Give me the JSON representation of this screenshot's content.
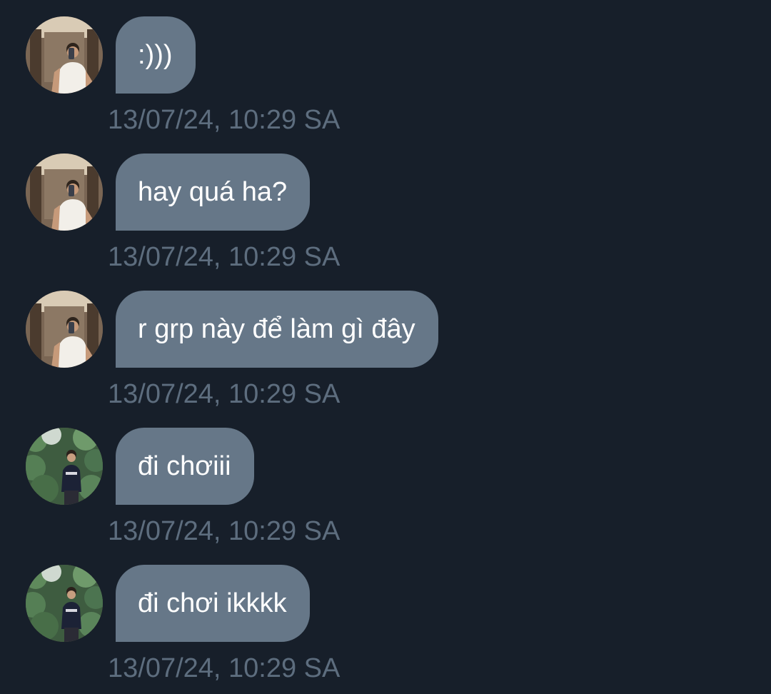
{
  "colors": {
    "background": "#171f2a",
    "bubble": "#667788",
    "message_text": "#ffffff",
    "timestamp": "#5d6d7e"
  },
  "messages": [
    {
      "avatar": "user-a-avatar",
      "text": ":)))",
      "time": "13/07/24, 10:29 SA"
    },
    {
      "avatar": "user-a-avatar",
      "text": "hay quá ha?",
      "time": "13/07/24, 10:29 SA"
    },
    {
      "avatar": "user-a-avatar",
      "text": "r grp này để làm gì đây",
      "time": "13/07/24, 10:29 SA"
    },
    {
      "avatar": "user-b-avatar",
      "text": "đi chơiii",
      "time": "13/07/24, 10:29 SA"
    },
    {
      "avatar": "user-b-avatar",
      "text": "đi chơi ikkkk",
      "time": "13/07/24, 10:29 SA"
    }
  ]
}
